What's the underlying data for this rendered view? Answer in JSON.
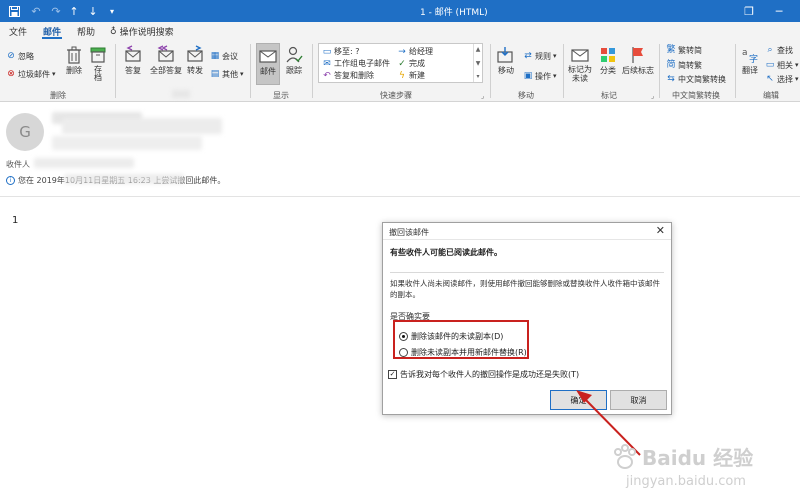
{
  "titlebar": {
    "title": "1 - 邮件 (HTML)",
    "restore_glyph": "❐",
    "minimize_glyph": "─",
    "quick_access": [
      "save-icon",
      "undo-icon",
      "redo-icon",
      "up-arrow-icon",
      "down-arrow-icon",
      "customize-icon"
    ]
  },
  "menu": {
    "tabs": [
      {
        "label": "文件",
        "active": false
      },
      {
        "label": "邮件",
        "active": true
      },
      {
        "label": "帮助",
        "active": false
      }
    ],
    "tell_me": "操作说明搜索"
  },
  "ribbon": {
    "delete_group": {
      "ignore": "忽略",
      "junk": "垃圾邮件",
      "delete": "删除",
      "archive": "存档",
      "label": "删除"
    },
    "respond_group": {
      "reply": "答复",
      "reply_all": "全部答复",
      "forward": "转发",
      "meeting": "会议",
      "more": "其他"
    },
    "show_group": {
      "message": "邮件",
      "track": "跟踪",
      "label": "显示"
    },
    "quick_steps": {
      "items": [
        "移至: ?",
        "工作组电子邮件",
        "答复和删除",
        "给经理",
        "完成",
        "新建"
      ],
      "label": "快速步骤"
    },
    "move_group": {
      "move": "移动",
      "rules": "规则",
      "actions": "操作",
      "label": "移动"
    },
    "tags_group": {
      "mark_unread": "标记为\n未读",
      "categorize": "分类",
      "follow_up": "后续标志",
      "label": "标记"
    },
    "chinese_group": {
      "to_simplified": "繁转简",
      "to_traditional": "简转繁",
      "conversion": "中文简繁转换",
      "label": "中文简繁转换"
    },
    "editing_group": {
      "translate": "翻译",
      "find": "查找",
      "related": "相关",
      "select": "选择",
      "label": "编辑"
    }
  },
  "message": {
    "avatar_text": "G",
    "recipients_label": "收件人",
    "info": "您在 2019年10月11日星期五 16:23 上尝试撤回此邮件。",
    "body": "1"
  },
  "dialog": {
    "title": "撤回该邮件",
    "close_glyph": "✕",
    "heading": "有些收件人可能已阅读此邮件。",
    "description": "如果收件人尚未阅读邮件，则使用邮件撤回能够删除或替换收件人收件箱中该邮件的副本。",
    "question": "是否确实要",
    "options": [
      {
        "label": "删除该邮件的未读副本(D)",
        "checked": true
      },
      {
        "label": "删除未读副本并用新邮件替换(R)",
        "checked": false
      }
    ],
    "report_checkbox": {
      "label": "告诉我对每个收件人的撤回操作是成功还是失败(T)",
      "checked": true
    },
    "ok": "确定",
    "cancel": "取消"
  },
  "watermark": {
    "brand": "Baidu 经验",
    "url": "jingyan.baidu.com"
  },
  "colors": {
    "titlebar": "#1f6fc5",
    "ribbon_bg": "#f3f3f3",
    "accent": "#1f6fc5",
    "highlight_red": "#c9211e"
  }
}
